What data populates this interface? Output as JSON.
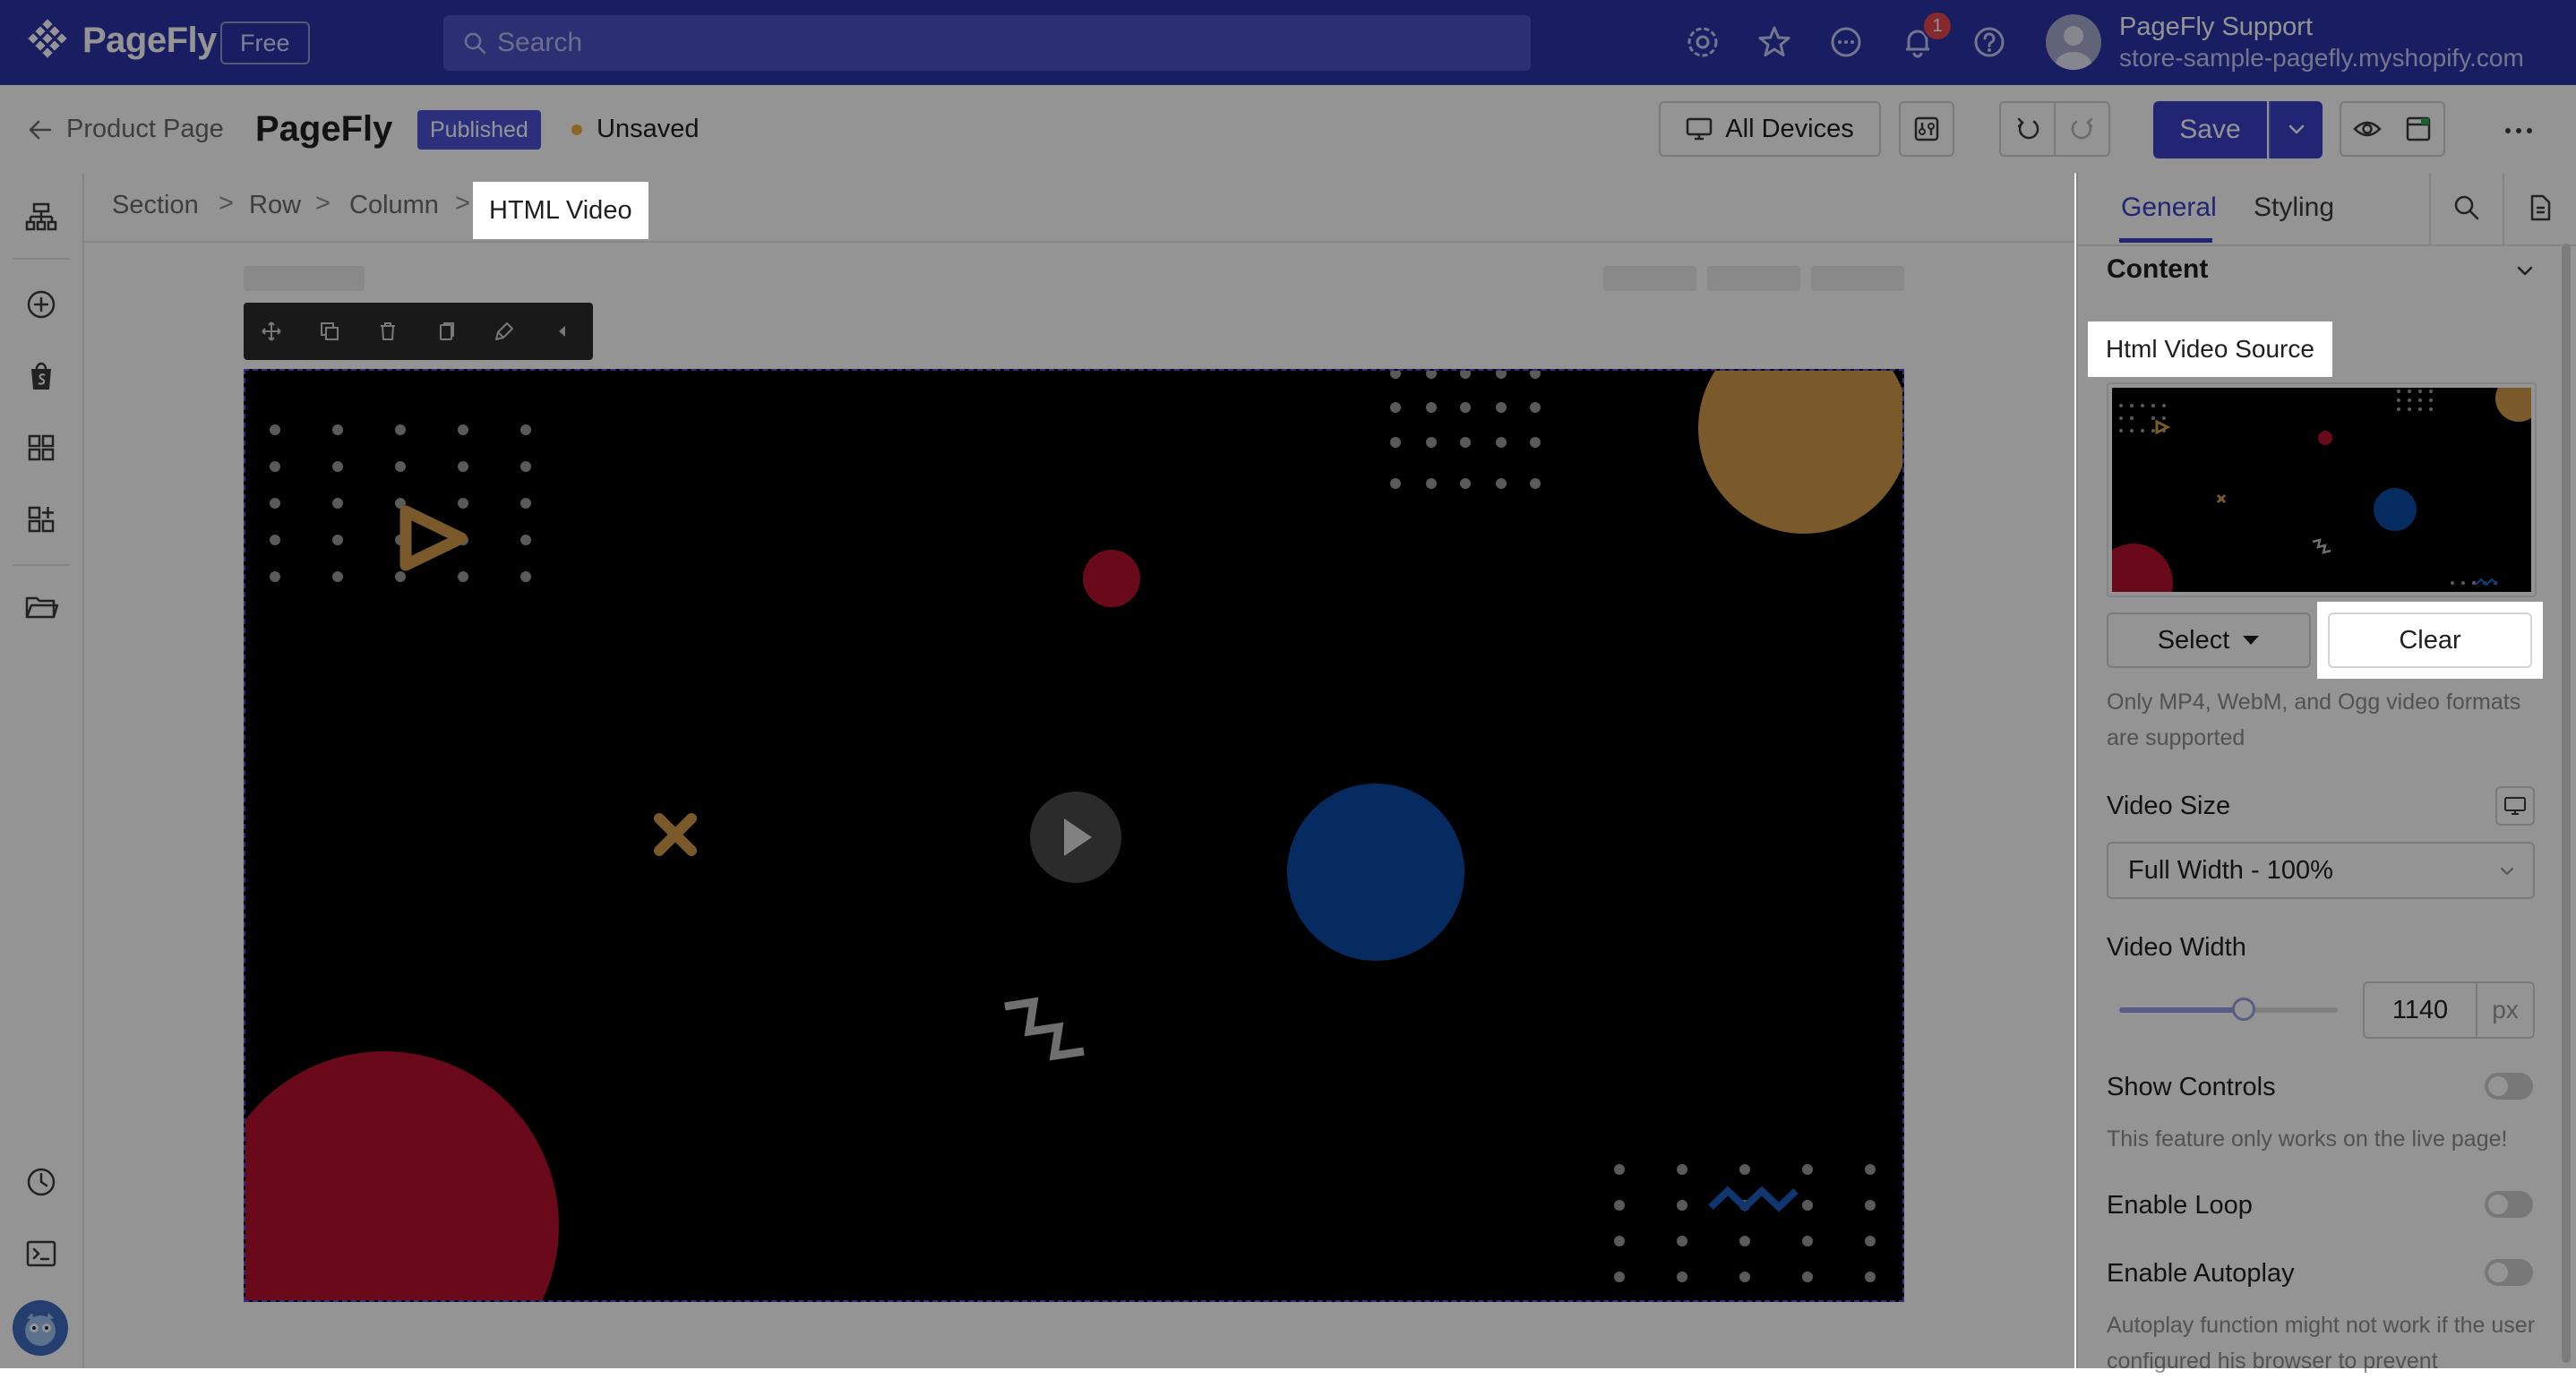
{
  "topbar": {
    "brand": "PageFly",
    "plan_badge": "Free",
    "search_placeholder": "Search",
    "notification_count": "1",
    "user_name": "PageFly Support",
    "user_store": "store-sample-pagefly.myshopify.com"
  },
  "editor_bar": {
    "back_label": "Product Page",
    "page_title": "PageFly",
    "status_badge": "Published",
    "unsaved_label": "Unsaved",
    "devices_label": "All Devices",
    "save_label": "Save"
  },
  "breadcrumb": [
    "Section",
    "Row",
    "Column",
    "HTML Video"
  ],
  "panel": {
    "tabs": [
      "General",
      "Styling"
    ],
    "active_tab": "General",
    "section_title": "Content",
    "video_source_label": "Html Video Source",
    "select_label": "Select",
    "clear_label": "Clear",
    "formats_help": "Only MP4, WebM, and Ogg video formats are supported",
    "video_size_label": "Video Size",
    "video_size_value": "Full Width - 100%",
    "video_width_label": "Video Width",
    "video_width_value": "1140",
    "video_width_unit": "px",
    "show_controls_label": "Show Controls",
    "show_controls_help": "This feature only works on the live page!",
    "enable_loop_label": "Enable Loop",
    "enable_autoplay_label": "Enable Autoplay",
    "autoplay_help": "Autoplay function might not work if the user configured his browser to prevent"
  },
  "colors": {
    "brand_blue": "#2c32a8",
    "accent": "#3a41c8",
    "video_red": "#b5102c",
    "video_orange": "#d39a4a",
    "video_blue": "#0a4aa6"
  }
}
